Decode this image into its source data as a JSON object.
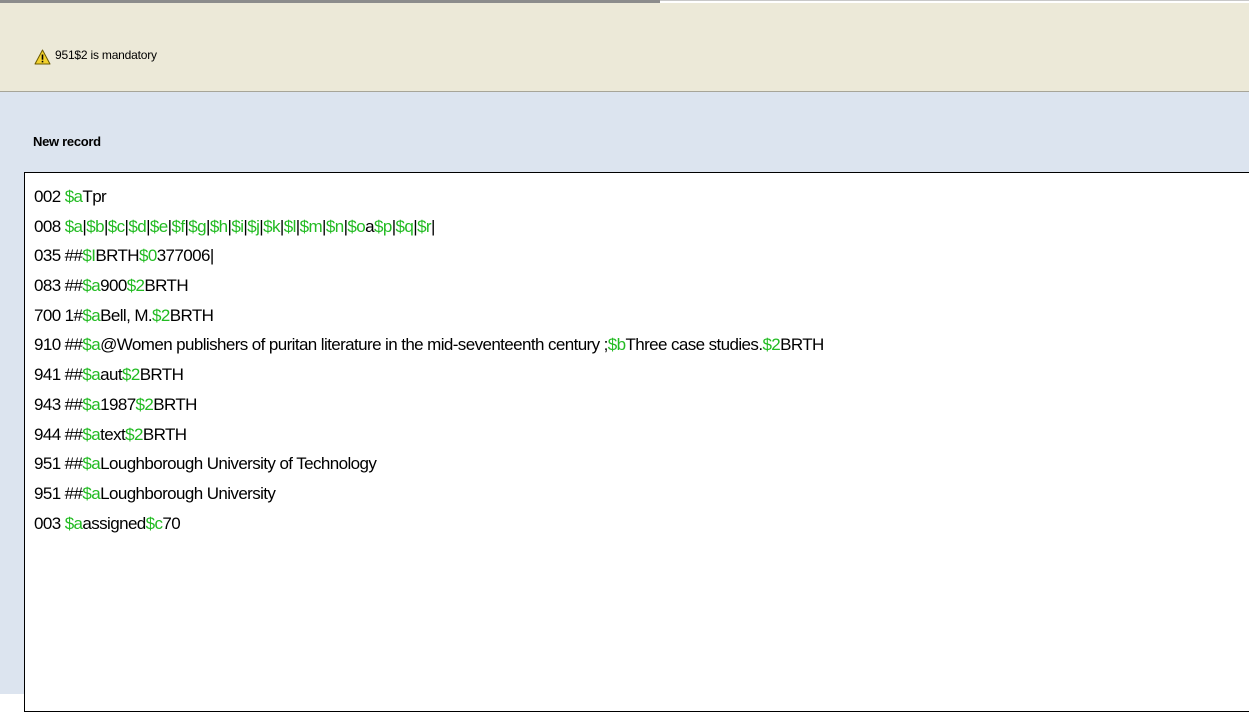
{
  "warning": {
    "icon": "warning-triangle-icon",
    "message": "951$2 is mandatory"
  },
  "panel": {
    "title": "New record"
  },
  "colors": {
    "subfield_code": "#22bb22",
    "warning_bar_bg": "#ece9d8",
    "panel_bg": "#dce4ef"
  },
  "record_lines": [
    {
      "segments": [
        {
          "t": "002 ",
          "sf": false
        },
        {
          "t": "$a",
          "sf": true
        },
        {
          "t": "Tpr",
          "sf": false
        }
      ]
    },
    {
      "segments": [
        {
          "t": "008 ",
          "sf": false
        },
        {
          "t": "$a",
          "sf": true
        },
        {
          "t": "|",
          "sf": false
        },
        {
          "t": "$b",
          "sf": true
        },
        {
          "t": "|",
          "sf": false
        },
        {
          "t": "$c",
          "sf": true
        },
        {
          "t": "|",
          "sf": false
        },
        {
          "t": "$d",
          "sf": true
        },
        {
          "t": "|",
          "sf": false
        },
        {
          "t": "$e",
          "sf": true
        },
        {
          "t": "|",
          "sf": false
        },
        {
          "t": "$f",
          "sf": true
        },
        {
          "t": "|",
          "sf": false
        },
        {
          "t": "$g",
          "sf": true
        },
        {
          "t": "|",
          "sf": false
        },
        {
          "t": "$h",
          "sf": true
        },
        {
          "t": "|",
          "sf": false
        },
        {
          "t": "$i",
          "sf": true
        },
        {
          "t": "|",
          "sf": false
        },
        {
          "t": "$j",
          "sf": true
        },
        {
          "t": "|",
          "sf": false
        },
        {
          "t": "$k",
          "sf": true
        },
        {
          "t": "|",
          "sf": false
        },
        {
          "t": "$l",
          "sf": true
        },
        {
          "t": "|",
          "sf": false
        },
        {
          "t": "$m",
          "sf": true
        },
        {
          "t": "|",
          "sf": false
        },
        {
          "t": "$n",
          "sf": true
        },
        {
          "t": "|",
          "sf": false
        },
        {
          "t": "$o",
          "sf": true
        },
        {
          "t": "a",
          "sf": false
        },
        {
          "t": "$p",
          "sf": true
        },
        {
          "t": "|",
          "sf": false
        },
        {
          "t": "$q",
          "sf": true
        },
        {
          "t": "|",
          "sf": false
        },
        {
          "t": "$r",
          "sf": true
        },
        {
          "t": "|",
          "sf": false
        }
      ]
    },
    {
      "segments": [
        {
          "t": "035 ##",
          "sf": false
        },
        {
          "t": "$I",
          "sf": true
        },
        {
          "t": "BRTH",
          "sf": false
        },
        {
          "t": "$0",
          "sf": true
        },
        {
          "t": "377006|",
          "sf": false
        }
      ]
    },
    {
      "segments": [
        {
          "t": "083 ##",
          "sf": false
        },
        {
          "t": "$a",
          "sf": true
        },
        {
          "t": "900",
          "sf": false
        },
        {
          "t": "$2",
          "sf": true
        },
        {
          "t": "BRTH",
          "sf": false
        }
      ]
    },
    {
      "segments": [
        {
          "t": "700 1#",
          "sf": false
        },
        {
          "t": "$a",
          "sf": true
        },
        {
          "t": "Bell, M.",
          "sf": false
        },
        {
          "t": "$2",
          "sf": true
        },
        {
          "t": "BRTH",
          "sf": false
        }
      ]
    },
    {
      "segments": [
        {
          "t": "910 ##",
          "sf": false
        },
        {
          "t": "$a",
          "sf": true
        },
        {
          "t": "@Women publishers of puritan literature in the mid-seventeenth century ;",
          "sf": false
        },
        {
          "t": "$b",
          "sf": true
        },
        {
          "t": "Three case studies.",
          "sf": false
        },
        {
          "t": "$2",
          "sf": true
        },
        {
          "t": "BRTH",
          "sf": false
        }
      ]
    },
    {
      "segments": [
        {
          "t": "941 ##",
          "sf": false
        },
        {
          "t": "$a",
          "sf": true
        },
        {
          "t": "aut",
          "sf": false
        },
        {
          "t": "$2",
          "sf": true
        },
        {
          "t": "BRTH",
          "sf": false
        }
      ]
    },
    {
      "segments": [
        {
          "t": "943 ##",
          "sf": false
        },
        {
          "t": "$a",
          "sf": true
        },
        {
          "t": "1987",
          "sf": false
        },
        {
          "t": "$2",
          "sf": true
        },
        {
          "t": "BRTH",
          "sf": false
        }
      ]
    },
    {
      "segments": [
        {
          "t": "944 ##",
          "sf": false
        },
        {
          "t": "$a",
          "sf": true
        },
        {
          "t": "text",
          "sf": false
        },
        {
          "t": "$2",
          "sf": true
        },
        {
          "t": "BRTH",
          "sf": false
        }
      ]
    },
    {
      "segments": [
        {
          "t": "951 ##",
          "sf": false
        },
        {
          "t": "$a",
          "sf": true
        },
        {
          "t": "Loughborough University of Technology",
          "sf": false
        }
      ]
    },
    {
      "segments": [
        {
          "t": "951 ##",
          "sf": false
        },
        {
          "t": "$a",
          "sf": true
        },
        {
          "t": "Loughborough University",
          "sf": false
        }
      ]
    },
    {
      "segments": [
        {
          "t": "003 ",
          "sf": false
        },
        {
          "t": "$a",
          "sf": true
        },
        {
          "t": "assigned",
          "sf": false
        },
        {
          "t": "$c",
          "sf": true
        },
        {
          "t": "70",
          "sf": false
        }
      ]
    }
  ]
}
